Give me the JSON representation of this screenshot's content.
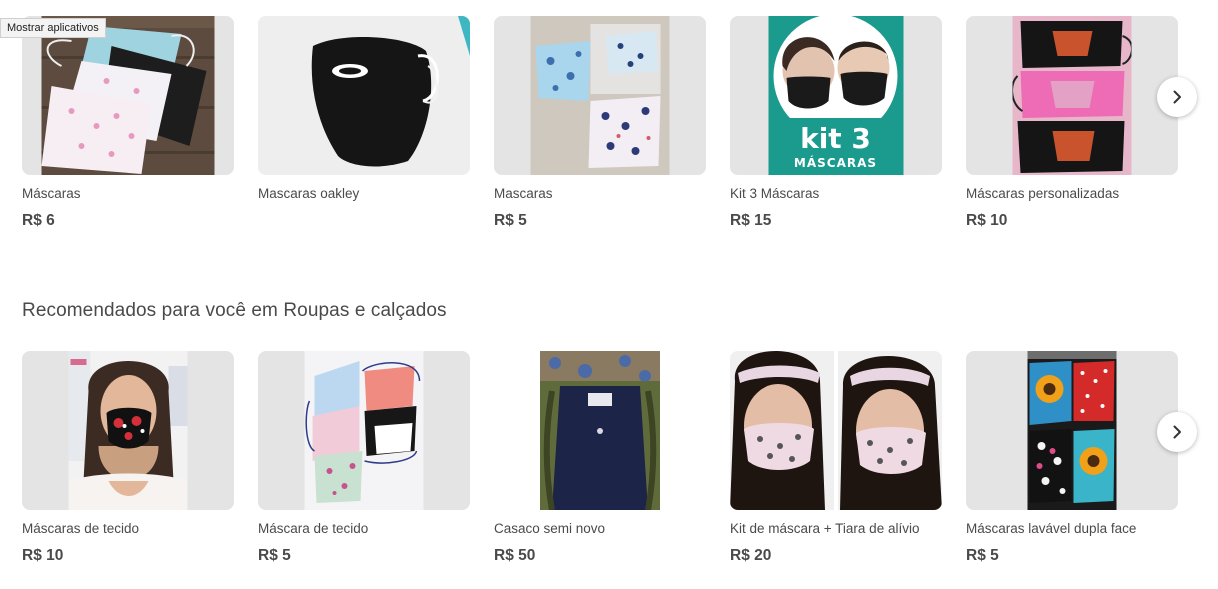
{
  "tooltip": "Mostrar aplicativos",
  "sections": [
    {
      "title": "",
      "items": [
        {
          "title": "Máscaras",
          "price": "R$ 6"
        },
        {
          "title": "Mascaras oakley",
          "price": ""
        },
        {
          "title": "Mascaras",
          "price": "R$ 5"
        },
        {
          "title": "Kit 3 Máscaras",
          "price": "R$ 15",
          "image_text_1": "kit 3",
          "image_text_2": "MÁSCARAS"
        },
        {
          "title": "Máscaras personalizadas",
          "price": "R$ 10"
        }
      ]
    },
    {
      "title": "Recomendados para você em Roupas e calçados",
      "items": [
        {
          "title": "Máscaras de tecido",
          "price": "R$ 10"
        },
        {
          "title": "Máscara de tecido",
          "price": "R$ 5"
        },
        {
          "title": "Casaco semi novo",
          "price": "R$ 50"
        },
        {
          "title": "Kit de máscara + Tiara de alívio",
          "price": "R$ 20"
        },
        {
          "title": "Máscaras lavável dupla face",
          "price": "R$ 5"
        }
      ]
    }
  ],
  "colors": {
    "text": "#4a4a4a",
    "thumb_bg": "#e4e4e4",
    "kit_teal": "#1b9a8e"
  },
  "icons": {
    "next": "chevron-right-icon"
  }
}
